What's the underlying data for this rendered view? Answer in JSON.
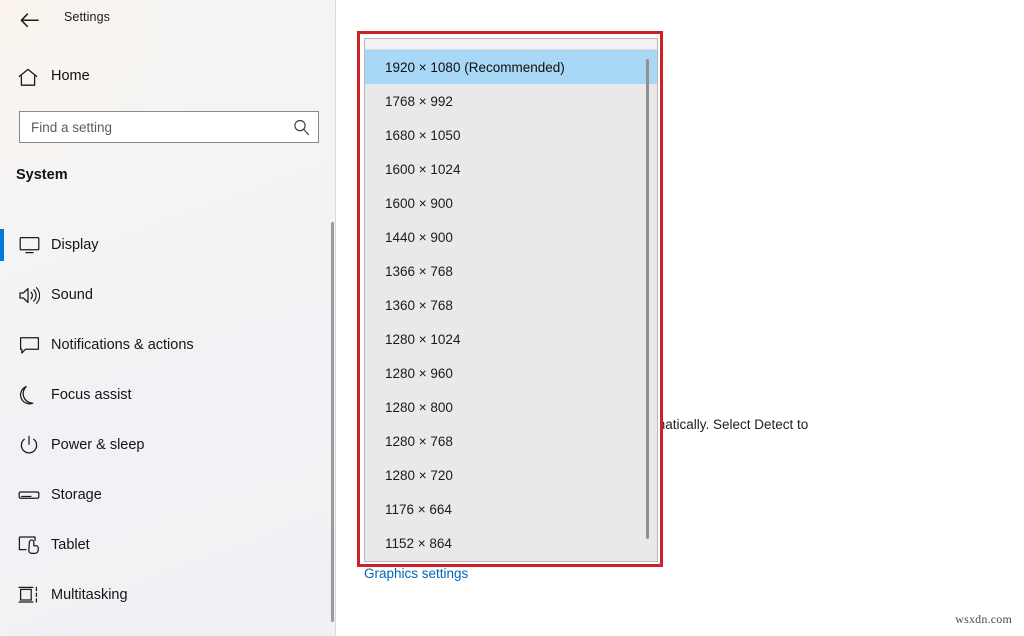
{
  "window": {
    "app_title": "Settings",
    "back_icon": "back-arrow-icon"
  },
  "sidebar": {
    "home": {
      "label": "Home",
      "icon": "home-icon"
    },
    "search": {
      "value": "",
      "placeholder": "Find a setting",
      "icon": "search-icon"
    },
    "section_title": "System",
    "items": [
      {
        "label": "Display",
        "icon": "monitor-icon",
        "selected": true
      },
      {
        "label": "Sound",
        "icon": "speaker-icon",
        "selected": false
      },
      {
        "label": "Notifications & actions",
        "icon": "chat-bubble-icon",
        "selected": false
      },
      {
        "label": "Focus assist",
        "icon": "moon-icon",
        "selected": false
      },
      {
        "label": "Power & sleep",
        "icon": "power-icon",
        "selected": false
      },
      {
        "label": "Storage",
        "icon": "drive-icon",
        "selected": false
      },
      {
        "label": "Tablet",
        "icon": "tablet-touch-icon",
        "selected": false
      },
      {
        "label": "Multitasking",
        "icon": "multitasking-icon",
        "selected": false
      }
    ]
  },
  "main": {
    "occluded_text": "matically. Select Detect to",
    "graphics_link": "Graphics settings",
    "watermark": "wsxdn.com"
  },
  "resolution_dropdown": {
    "highlight_color": "#a8d8f5",
    "callout_color": "#cc2127",
    "selected_index": 0,
    "options": [
      "1920 × 1080 (Recommended)",
      "1768 × 992",
      "1680 × 1050",
      "1600 × 1024",
      "1600 × 900",
      "1440 × 900",
      "1366 × 768",
      "1360 × 768",
      "1280 × 1024",
      "1280 × 960",
      "1280 × 800",
      "1280 × 768",
      "1280 × 720",
      "1176 × 664",
      "1152 × 864"
    ]
  }
}
